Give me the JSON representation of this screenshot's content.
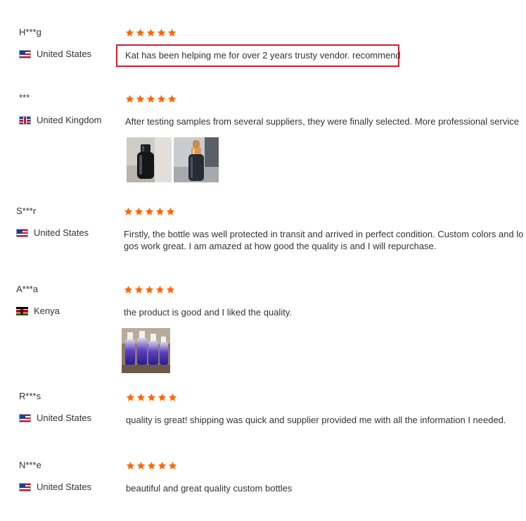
{
  "colors": {
    "star": "#ff6600",
    "highlight_border": "#d0202f",
    "text": "#333333"
  },
  "reviews": [
    {
      "name": "H***g",
      "country": "United States",
      "flag_icon": "us-flag-icon",
      "rating": 5,
      "comment": "Kat has been helping me for over 2 years trusty vendor. recommend",
      "highlighted": true
    },
    {
      "name": "***",
      "country": "United Kingdom",
      "flag_icon": "uk-flag-icon",
      "rating": 5,
      "comment": "After testing samples from several suppliers, they were finally selected. More professional service",
      "photos": [
        "black-bottle-photo",
        "amber-dropper-bottle-photo"
      ]
    },
    {
      "name": "S***r",
      "country": "United States",
      "flag_icon": "us-flag-icon",
      "rating": 5,
      "comment_lines": [
        "Firstly, the bottle was well protected in transit and arrived in perfect condition. Custom colors and lo",
        "gos work great. I am amazed at how good the quality is and I will repurchase."
      ]
    },
    {
      "name": "A***a",
      "country": "Kenya",
      "flag_icon": "kenya-flag-icon",
      "rating": 5,
      "comment": "the product is good and I liked the quality.",
      "photos": [
        "gradient-purple-bottles-photo"
      ]
    },
    {
      "name": "R***s",
      "country": "United States",
      "flag_icon": "us-flag-icon",
      "rating": 5,
      "comment": "quality is great! shipping was quick and supplier provided me with all the information I needed."
    },
    {
      "name": "N***e",
      "country": "United States",
      "flag_icon": "us-flag-icon",
      "rating": 5,
      "comment": "beautiful and great quality custom bottles"
    }
  ]
}
